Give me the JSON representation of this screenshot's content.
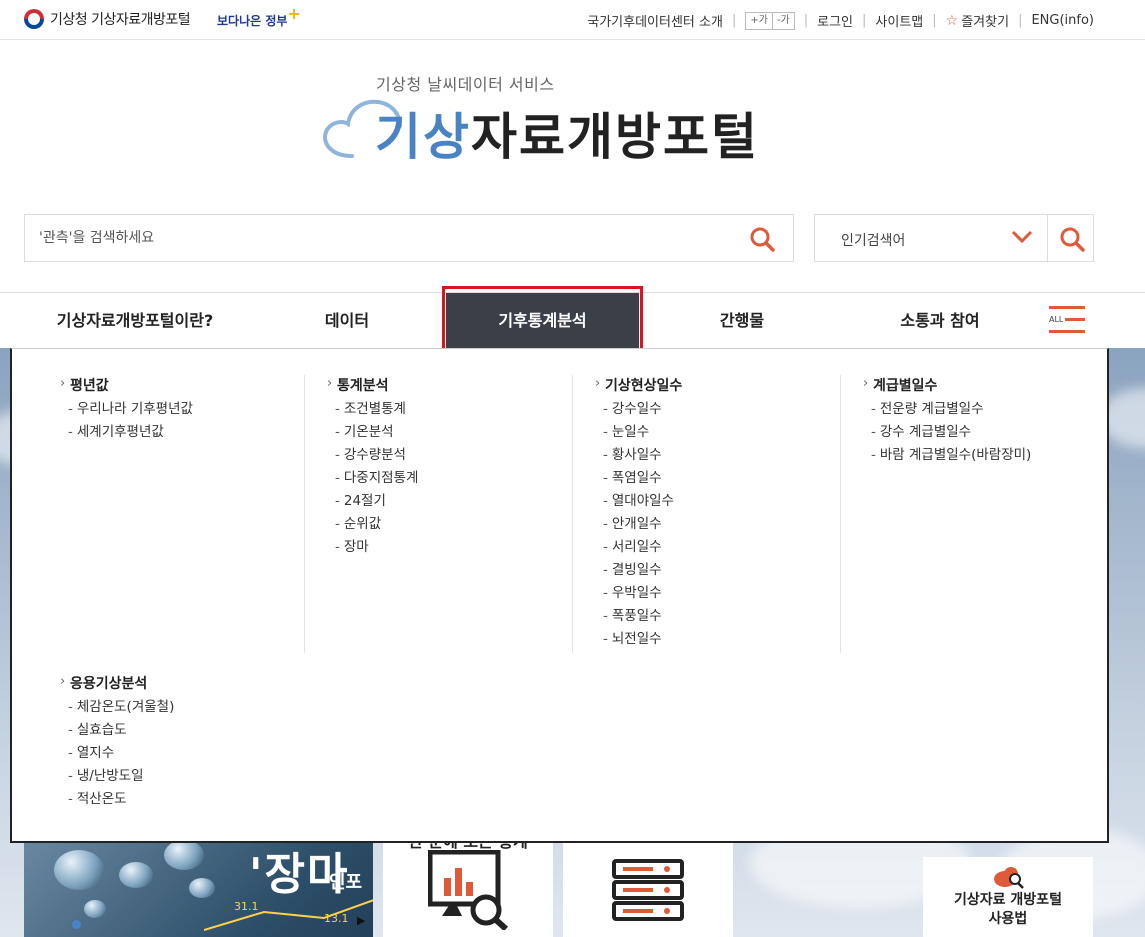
{
  "topbar": {
    "gov_name": "기상청 기상자료개방포털",
    "better_gov": "보다나은 정부",
    "links": {
      "about": "국가기후데이터센터 소개",
      "font_plus": "+가",
      "font_minus": "-가",
      "login": "로그인",
      "sitemap": "사이트맵",
      "favorites": "즐겨찾기",
      "english": "ENG(info)"
    }
  },
  "header": {
    "subtitle": "기상청 날씨데이터 서비스",
    "title_accent": "기상",
    "title_rest": "자료개방포털"
  },
  "search": {
    "placeholder": "'관측'을 검색하세요",
    "popular_label": "인기검색어"
  },
  "nav": {
    "items": [
      {
        "label": "기상자료개방포털이란?"
      },
      {
        "label": "데이터"
      },
      {
        "label": "기후통계분석"
      },
      {
        "label": "간행물"
      },
      {
        "label": "소통과 참여"
      }
    ],
    "all_label": "ALL"
  },
  "mega_menu": {
    "columns": [
      {
        "title": "평년값",
        "items": [
          "우리나라 기후평년값",
          "세계기후평년값"
        ]
      },
      {
        "title": "통계분석",
        "items": [
          "조건별통계",
          "기온분석",
          "강수량분석",
          "다중지점통계",
          "24절기",
          "순위값",
          "장마"
        ]
      },
      {
        "title": "기상현상일수",
        "items": [
          "강수일수",
          "눈일수",
          "황사일수",
          "폭염일수",
          "열대야일수",
          "안개일수",
          "서리일수",
          "결빙일수",
          "우박일수",
          "폭풍일수",
          "뇌전일수"
        ]
      },
      {
        "title": "계급별일수",
        "items": [
          "전운량 계급별일수",
          "강수 계급별일수",
          "바람 계급별일수(바람장미)"
        ]
      },
      {
        "title": "응용기상분석",
        "items": [
          "체감온도(겨울철)",
          "실효습도",
          "열지수",
          "냉/난방도일",
          "적산온도"
        ]
      }
    ]
  },
  "tiles": {
    "rain_big": "'장마",
    "rain_small": "인포",
    "rain_num1": "31.1",
    "rain_num2": "13.1",
    "rain_play": "▶",
    "stats_caption": "한 눈에 보는 통계",
    "guide_label_1": "기상자료 개방포털",
    "guide_label_2": "사용법"
  },
  "colors": {
    "accent_blue": "#4a83c4",
    "accent_orange": "#e05a3a",
    "nav_active_bg": "#3b3f47",
    "highlight_red": "#e0121e"
  }
}
